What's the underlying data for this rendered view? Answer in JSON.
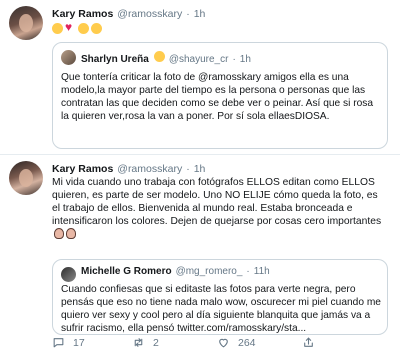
{
  "tweets": [
    {
      "name": "Kary Ramos",
      "handle": "@ramosskary",
      "dot": "·",
      "time": "1h",
      "quote": {
        "name": "Sharlyn Ureña",
        "handle": "@shayure_cr",
        "dot": "·",
        "time": "1h",
        "text": "Que tontería criticar la foto de @ramosskary amigos ella es una modelo,la mayor parte del tiempo es la persona o personas que las contratan las que deciden como se debe ver o peinar. Así que si rosa la quieren ver,rosa la van a poner. Por sí sola ellaesDIOSA."
      }
    },
    {
      "name": "Kary Ramos",
      "handle": "@ramosskary",
      "dot": "·",
      "time": "1h",
      "text": "Mi vida cuando uno trabaja con fotógrafos ELLOS editan como ELLOS quieren, es parte de ser modelo. Uno NO ELIJE cómo queda la foto, es el trabajo de ellos. Bienvenida al mundo real. Estaba bronceada e intensificaron los colores. Dejen de quejarse por cosas cero importantes",
      "quote": {
        "name": "Michelle G Romero",
        "handle": "@mg_romero_",
        "dot": "·",
        "time": "11h",
        "text": "Cuando confiesas que si editaste las fotos para verte negra, pero pensás que eso no tiene nada malo wow, oscurecer mi piel cuando me quiero ver sexy y cool pero al día siguiente blanquita que jamás va a sufrir racismo, ella pensó twitter.com/ramosskary/sta..."
      },
      "actions": {
        "replies": "17",
        "retweets": "2",
        "likes": "264"
      }
    }
  ],
  "icons": {
    "reply": "reply-icon",
    "retweet": "retweet-icon",
    "like": "like-icon",
    "share": "share-icon"
  },
  "colors": {
    "text": "#14171a",
    "muted": "#657786",
    "border": "#ccd6dd",
    "divider": "#e6ecf0"
  }
}
